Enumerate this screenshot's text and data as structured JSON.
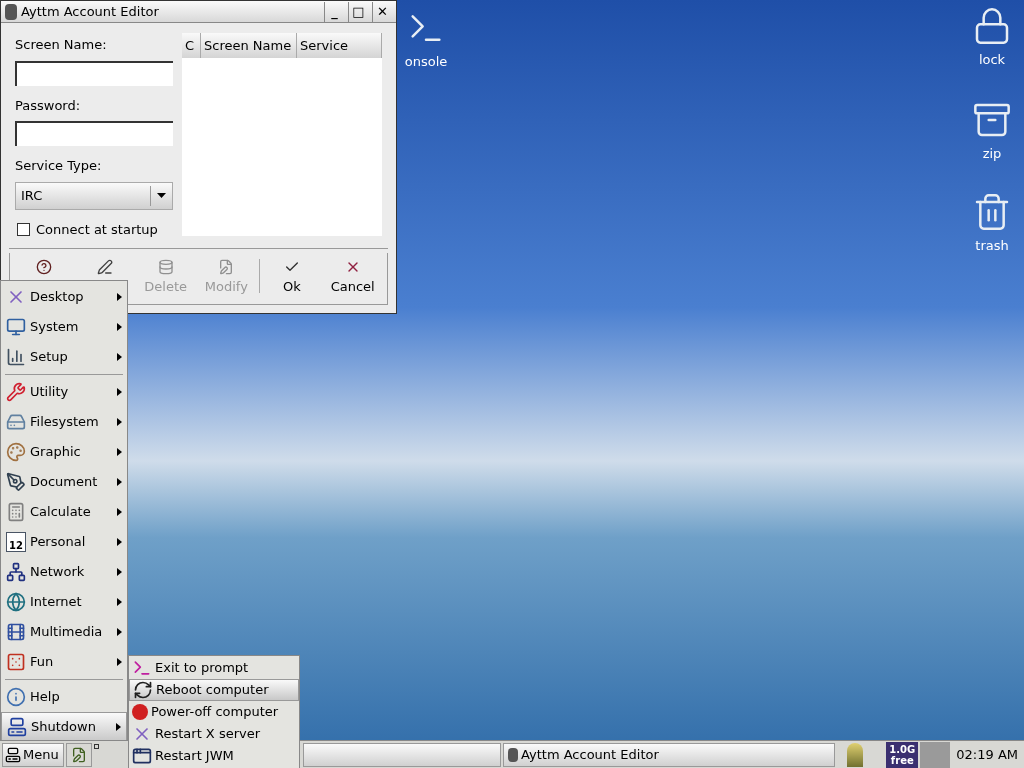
{
  "desktop_icons": [
    {
      "kind": "console",
      "label": "onsole"
    },
    {
      "kind": "lock",
      "label": "lock"
    },
    {
      "kind": "zip",
      "label": "zip"
    },
    {
      "kind": "trash",
      "label": "trash"
    }
  ],
  "window": {
    "title": "Ayttm Account Editor",
    "controls": [
      "_",
      "□",
      "✕"
    ],
    "fields": [
      {
        "label": "Screen Name:"
      },
      {
        "label": "Password:"
      }
    ],
    "service": {
      "label": "Service Type:",
      "value": "IRC"
    },
    "connect": {
      "label": "Connect at startup",
      "checked": false
    },
    "table": {
      "columns": [
        "C",
        "Screen Name",
        "Service"
      ]
    },
    "toolbar": [
      {
        "kind": "help",
        "disabled": false
      },
      {
        "kind": "edit",
        "disabled": false
      },
      {
        "kind": "delete",
        "label": "Delete",
        "disabled": true
      },
      {
        "kind": "modify",
        "label": "Modify",
        "disabled": true
      },
      {
        "kind": "ok",
        "label": "Ok",
        "disabled": false
      },
      {
        "kind": "cancel",
        "label": "Cancel",
        "disabled": false
      }
    ]
  },
  "menu": {
    "groups": [
      [
        {
          "label": "Desktop",
          "submenu": true,
          "selected": false
        },
        {
          "label": "System",
          "submenu": true,
          "selected": false
        },
        {
          "label": "Setup",
          "submenu": true,
          "selected": false
        }
      ],
      [
        {
          "label": "Utility",
          "submenu": true,
          "selected": false
        },
        {
          "label": "Filesystem",
          "submenu": true,
          "selected": false
        },
        {
          "label": "Graphic",
          "submenu": true,
          "selected": false
        },
        {
          "label": "Document",
          "submenu": true,
          "selected": false
        },
        {
          "label": "Calculate",
          "submenu": true,
          "selected": false
        },
        {
          "label": "Personal",
          "submenu": true,
          "selected": false,
          "badge": "12"
        },
        {
          "label": "Network",
          "submenu": true,
          "selected": false
        },
        {
          "label": "Internet",
          "submenu": true,
          "selected": false
        },
        {
          "label": "Multimedia",
          "submenu": true,
          "selected": false
        },
        {
          "label": "Fun",
          "submenu": true,
          "selected": false
        }
      ],
      [
        {
          "label": "Help",
          "submenu": false,
          "selected": false
        },
        {
          "label": "Shutdown",
          "submenu": true,
          "selected": true
        }
      ]
    ]
  },
  "submenu": {
    "items": [
      {
        "label": "Exit to prompt",
        "selected": false
      },
      {
        "label": "Reboot computer",
        "selected": true
      },
      {
        "label": "Power-off computer",
        "selected": false
      },
      {
        "label": "Restart X server",
        "selected": false
      },
      {
        "label": "Restart JWM",
        "selected": false
      }
    ]
  },
  "taskbar": {
    "menu_button": "Menu",
    "tasks": [
      {
        "selected": false
      },
      {
        "label": "Ayttm Account Editor",
        "selected": false
      }
    ],
    "memory": "1.0G free",
    "clock": "02:19 AM"
  }
}
